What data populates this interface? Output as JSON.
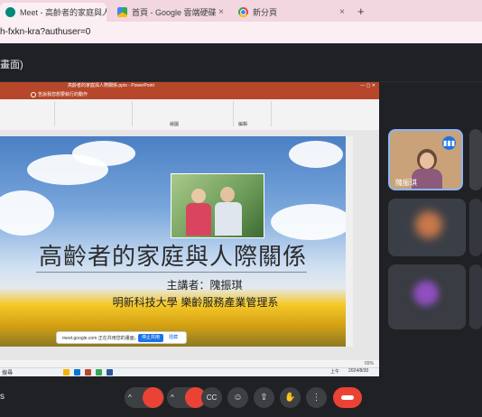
{
  "browser": {
    "tabs": [
      {
        "label": "Meet - 高齡者的家庭與人際",
        "icon": "meet-icon",
        "active": true
      },
      {
        "label": "首頁 - Google 雲端硬碟",
        "icon": "drive-icon",
        "active": false
      },
      {
        "label": "新分頁",
        "icon": "chrome-icon",
        "active": false
      }
    ],
    "close_glyph": "×",
    "new_tab_glyph": "+",
    "url": "h-fxkn-kra?authuser=0"
  },
  "meet": {
    "title": "畫面)"
  },
  "presentation": {
    "window_title": "高齡者的家庭與人際關係.pptx - PowerPoint",
    "search_hint": "告訴我您想要執行的動作",
    "ribbon_labels": [
      "繪圖",
      "編輯"
    ],
    "slide": {
      "title": "高齡者的家庭與人際關係",
      "speaker": "主講者：隗振琪",
      "affiliation": "明新科技大學 樂齡服務產業管理系"
    },
    "notification": {
      "text": "meet.google.com 正在共用您的畫面。",
      "primary": "停止共用",
      "secondary": "隱藏"
    },
    "taskbar_search": "搜尋",
    "zoom": "65%",
    "clock_time": "上午",
    "clock_date": "2024/8/30"
  },
  "participants": [
    {
      "name": "隗振琪",
      "speaking": true
    }
  ],
  "controls": {
    "mic_label": "mic",
    "cam_label": "cam",
    "cc_label": "CC",
    "end_label": "end"
  },
  "colors": {
    "accent": "#1a73e8",
    "end_call": "#ea4335",
    "ppt_brand": "#b7472a"
  }
}
